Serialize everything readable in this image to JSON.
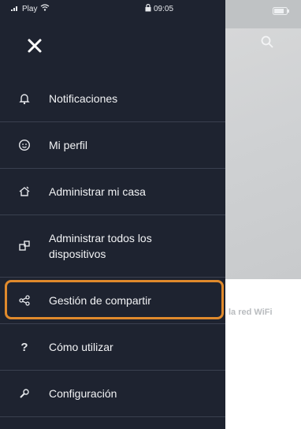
{
  "status_bar": {
    "carrier": "Play",
    "time": "09:05"
  },
  "background": {
    "partial_text": "la red WiFi"
  },
  "menu": {
    "items": [
      {
        "label": "Notificaciones",
        "icon": "bell-icon"
      },
      {
        "label": "Mi perfil",
        "icon": "profile-icon"
      },
      {
        "label": "Administrar mi casa",
        "icon": "home-icon"
      },
      {
        "label": "Administrar todos los dispositivos",
        "icon": "devices-icon"
      },
      {
        "label": "Gestión de compartir",
        "icon": "share-icon",
        "highlighted": true
      },
      {
        "label": "Cómo utilizar",
        "icon": "question-icon"
      },
      {
        "label": "Configuración",
        "icon": "settings-icon"
      }
    ]
  },
  "colors": {
    "drawer_bg": "#1e2330",
    "highlight": "#e08a2c",
    "divider": "#3a404f"
  }
}
